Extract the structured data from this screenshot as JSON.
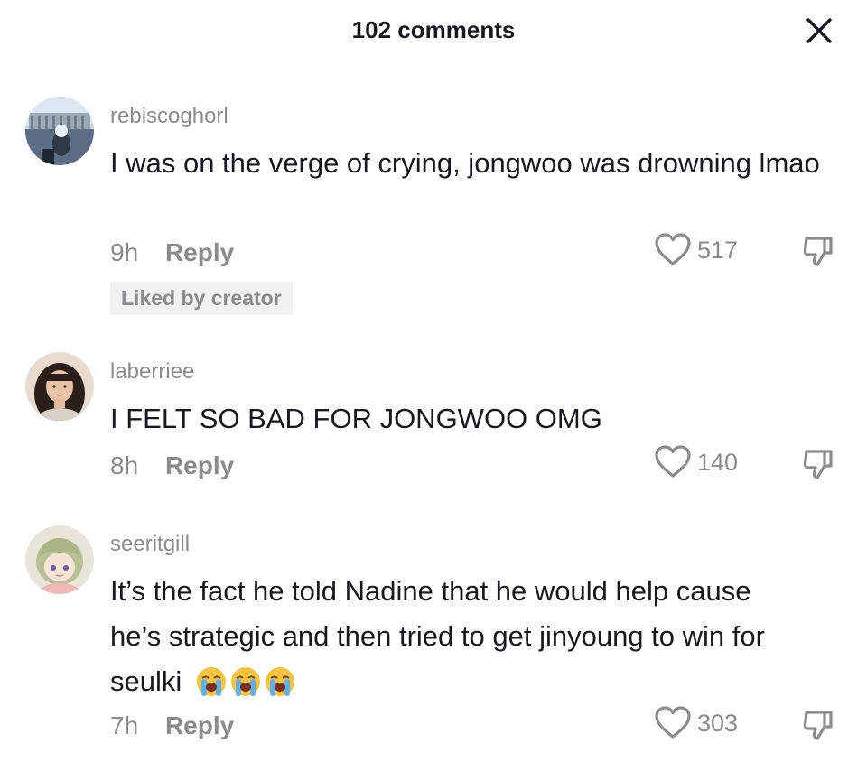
{
  "header": {
    "title": "102 comments",
    "close_icon": "close-icon"
  },
  "comments": [
    {
      "username": "rebiscoghorl",
      "text": "I was on the verge of crying, jongwoo was drowning lmao",
      "time": "9h",
      "reply_label": "Reply",
      "likes": "517",
      "badge": "Liked by creator"
    },
    {
      "username": "laberriee",
      "text": "I FELT SO BAD FOR JONGWOO OMG",
      "time": "8h",
      "reply_label": "Reply",
      "likes": "140"
    },
    {
      "username": "seeritgill",
      "text_line1": "It’s the fact he told Nadine that he would help cause",
      "text_line2": "he’s strategic and then tried to get jinyoung to win for",
      "text_line3": "seulki",
      "emojis": [
        "loudly-crying-face-emoji",
        "loudly-crying-face-emoji",
        "loudly-crying-face-emoji"
      ],
      "time": "7h",
      "reply_label": "Reply",
      "likes": "303"
    }
  ],
  "icons": {
    "like": "heart-icon",
    "dislike": "thumbs-down-icon"
  }
}
